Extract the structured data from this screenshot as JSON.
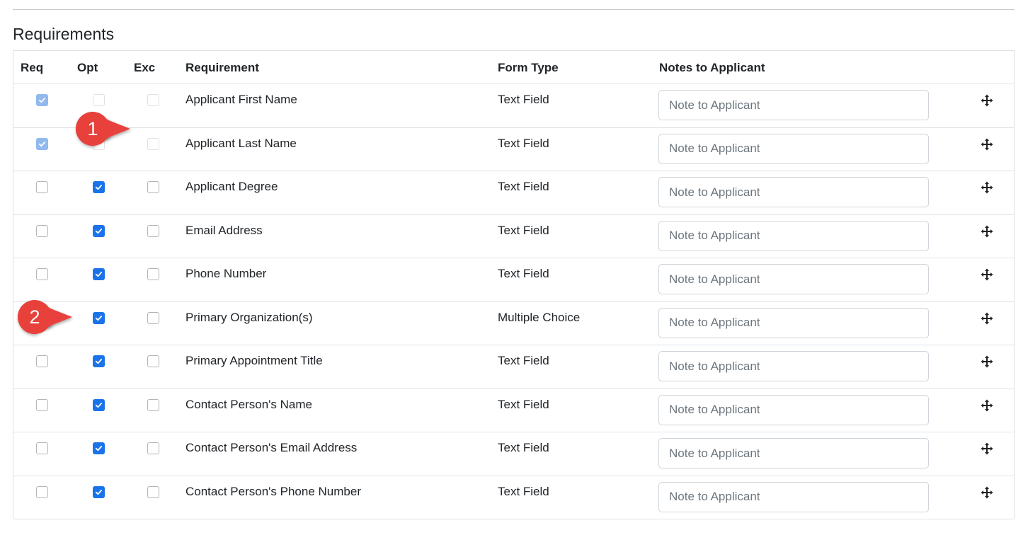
{
  "section": {
    "title": "Requirements"
  },
  "columns": {
    "req": "Req",
    "opt": "Opt",
    "exc": "Exc",
    "requirement": "Requirement",
    "form_type": "Form Type",
    "notes": "Notes to Applicant"
  },
  "placeholder": "Note to Applicant",
  "rows": [
    {
      "name": "Applicant First Name",
      "form_type": "Text Field",
      "req": true,
      "opt": false,
      "exc": false,
      "locked": true
    },
    {
      "name": "Applicant Last Name",
      "form_type": "Text Field",
      "req": true,
      "opt": false,
      "exc": false,
      "locked": true
    },
    {
      "name": "Applicant Degree",
      "form_type": "Text Field",
      "req": false,
      "opt": true,
      "exc": false,
      "locked": false
    },
    {
      "name": "Email Address",
      "form_type": "Text Field",
      "req": false,
      "opt": true,
      "exc": false,
      "locked": false
    },
    {
      "name": "Phone Number",
      "form_type": "Text Field",
      "req": false,
      "opt": true,
      "exc": false,
      "locked": false
    },
    {
      "name": "Primary Organization(s)",
      "form_type": "Multiple Choice",
      "req": false,
      "opt": true,
      "exc": false,
      "locked": false
    },
    {
      "name": "Primary Appointment Title",
      "form_type": "Text Field",
      "req": false,
      "opt": true,
      "exc": false,
      "locked": false
    },
    {
      "name": "Contact Person's Name",
      "form_type": "Text Field",
      "req": false,
      "opt": true,
      "exc": false,
      "locked": false
    },
    {
      "name": "Contact Person's Email Address",
      "form_type": "Text Field",
      "req": false,
      "opt": true,
      "exc": false,
      "locked": false
    },
    {
      "name": "Contact Person's Phone Number",
      "form_type": "Text Field",
      "req": false,
      "opt": true,
      "exc": false,
      "locked": false
    }
  ],
  "callouts": [
    {
      "label": "1"
    },
    {
      "label": "2"
    }
  ],
  "colors": {
    "checked": "#1a73e8",
    "checked_disabled": "#91b9ee",
    "callout": "#e8413c"
  },
  "icons": {
    "move": "move-icon"
  }
}
